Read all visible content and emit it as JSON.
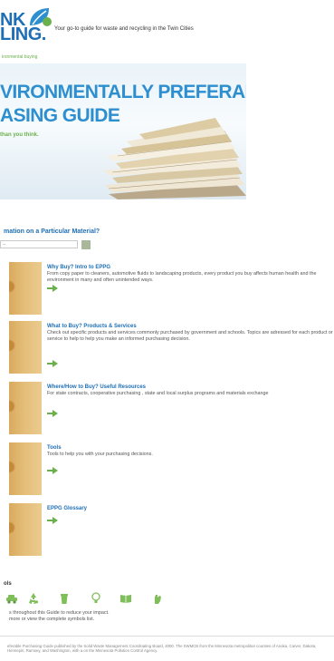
{
  "header": {
    "logo_line1": "NK",
    "logo_line2": "LING.",
    "tagline": "Your go-to guide for waste and recycling in the Twin Cities",
    "breadcrumb": "ironmental buying"
  },
  "hero": {
    "line1": "VIRONMENTALLY PREFERABLE",
    "line2": "ASING GUIDE",
    "subtitle": "than you think."
  },
  "finder": {
    "heading": "mation on a Particular Material?",
    "select_value": "--"
  },
  "items": [
    {
      "title": "Why Buy? Intro to EPPG",
      "desc": "From copy paper to cleaners, automotive fluids to landscaping products, every product you buy affects human health and the environment in many and often unintended ways."
    },
    {
      "title": "What to Buy? Products & Services",
      "desc": "Check out specific products and services commonly purchased by government and schools. Topics are adressed for each product or service to help to help you make an informed purchasing  decision."
    },
    {
      "title": "Where/How to Buy? Useful Resources",
      "desc": "For state contracts, cooperative purchasing , state and local surplus  programs and materials exchange"
    },
    {
      "title": "Tools",
      "desc": "Tools to help you with your purchasing decisions."
    },
    {
      "title": "EPPG Glossary",
      "desc": ""
    }
  ],
  "symbols": {
    "heading": "ols",
    "text_line1": "s throughout this Guide to reduce your impact.",
    "text_line2": "more or view the complete symbols list."
  },
  "footer": {
    "text": "eferable Purchasing Guide published by the Solid Waste Management Coordinating Board, 4000. The SWMCB from the Minnesota metropolitan counties of Anoka, Carver, Dakota, Hennepin, Ramsey, and Washington, with a on the Minnesota Pollution Control Agency."
  },
  "colors": {
    "brand_blue": "#1e6fb5",
    "hero_blue": "#2e8fd0",
    "accent_green": "#6ab04c"
  }
}
